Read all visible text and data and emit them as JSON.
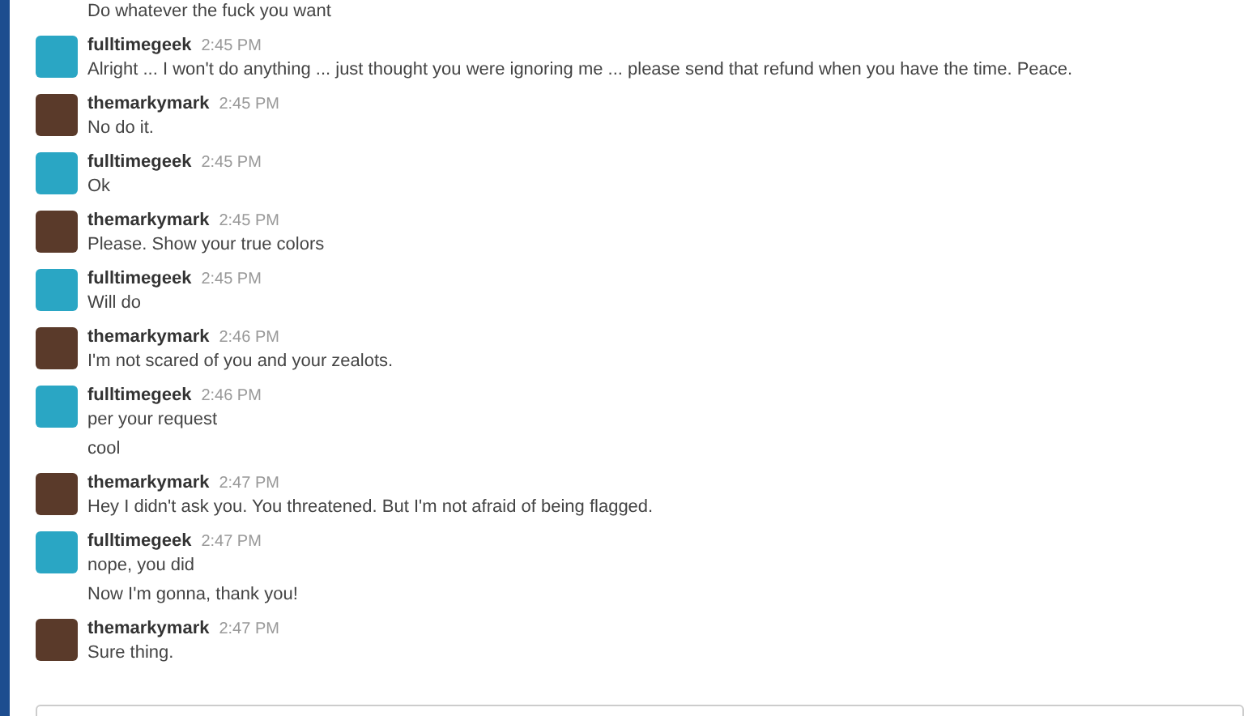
{
  "continuation": "Do whatever the fuck you want",
  "messages": [
    {
      "author": "fulltimegeek",
      "time": "2:45 PM",
      "color": "#2aa6c4",
      "lines": [
        "Alright ... I won't do anything ... just thought you were ignoring me ... please send that refund when you have the time. Peace."
      ]
    },
    {
      "author": "themarkymark",
      "time": "2:45 PM",
      "color": "#5a3a2a",
      "lines": [
        "No do it."
      ]
    },
    {
      "author": "fulltimegeek",
      "time": "2:45 PM",
      "color": "#2aa6c4",
      "lines": [
        "Ok"
      ]
    },
    {
      "author": "themarkymark",
      "time": "2:45 PM",
      "color": "#5a3a2a",
      "lines": [
        "Please. Show your true colors"
      ]
    },
    {
      "author": "fulltimegeek",
      "time": "2:45 PM",
      "color": "#2aa6c4",
      "lines": [
        "Will do"
      ]
    },
    {
      "author": "themarkymark",
      "time": "2:46 PM",
      "color": "#5a3a2a",
      "lines": [
        "I'm not scared of you and your zealots."
      ]
    },
    {
      "author": "fulltimegeek",
      "time": "2:46 PM",
      "color": "#2aa6c4",
      "lines": [
        "per your request",
        "cool"
      ]
    },
    {
      "author": "themarkymark",
      "time": "2:47 PM",
      "color": "#5a3a2a",
      "lines": [
        "Hey I didn't ask you. You threatened. But I'm not afraid of being flagged."
      ]
    },
    {
      "author": "fulltimegeek",
      "time": "2:47 PM",
      "color": "#2aa6c4",
      "lines": [
        "nope, you did",
        "Now I'm gonna, thank you!"
      ]
    },
    {
      "author": "themarkymark",
      "time": "2:47 PM",
      "color": "#5a3a2a",
      "lines": [
        "Sure thing."
      ]
    }
  ]
}
